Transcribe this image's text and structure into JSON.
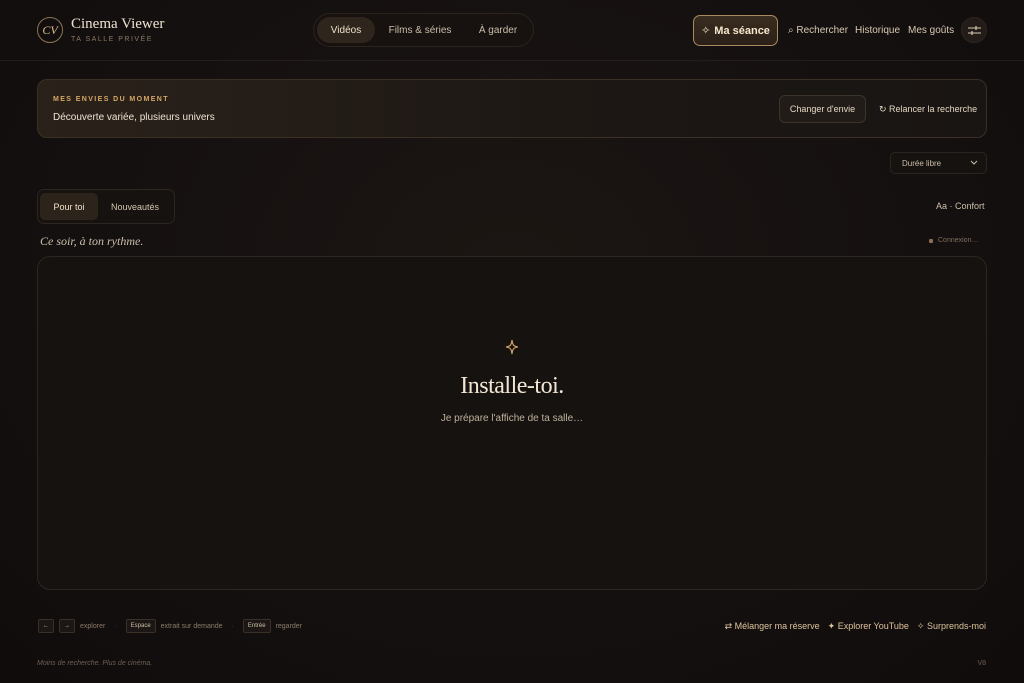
{
  "brand": {
    "logo": "CV",
    "name": "Cinema Viewer",
    "tagline": "TA SALLE PRIVÉE"
  },
  "nav": {
    "tabs": [
      {
        "label": "Vidéos",
        "active": true
      },
      {
        "label": "Films & séries",
        "active": false
      },
      {
        "label": "À garder",
        "active": false
      }
    ]
  },
  "header": {
    "seance_icon": "✧",
    "seance_label": "Ma séance",
    "search_label": "⌕ Rechercher",
    "history_label": "Historique",
    "tastes_label": "Mes goûts",
    "settings_icon": "sliders-icon"
  },
  "mood": {
    "kicker": "MES ENVIES DU MOMENT",
    "text": "Découverte variée, plusieurs univers",
    "change_label": "Changer d'envie",
    "relaunch_label": "↻ Relancer la recherche"
  },
  "duration": {
    "selected": "Durée libre"
  },
  "feed_tabs": [
    {
      "label": "Pour toi",
      "active": true
    },
    {
      "label": "Nouveautés",
      "active": false
    }
  ],
  "comfort_label": "Aa · Confort",
  "tonight": "Ce soir, à ton rythme.",
  "status": "Connexion…",
  "panel": {
    "icon": "sparkle-icon",
    "title": "Installe-toi.",
    "subtitle": "Je prépare l'affiche de ta salle…"
  },
  "shortcuts": {
    "left_key": "←",
    "right_key": "→",
    "explore": "explorer",
    "space_key": "Espace",
    "space_desc": "extrait sur demande",
    "enter_key": "Entrée",
    "enter_desc": "regarder",
    "separator": "·"
  },
  "actions": {
    "shuffle": "⇄ Mélanger ma réserve",
    "youtube": "✦ Explorer YouTube",
    "surprise": "✧ Surprends-moi"
  },
  "footer": {
    "tagline": "Moins de recherche. Plus de cinéma.",
    "version": "V8"
  },
  "colors": {
    "accent": "#d6a867",
    "background": "#141010",
    "text": "#e8dccb"
  }
}
